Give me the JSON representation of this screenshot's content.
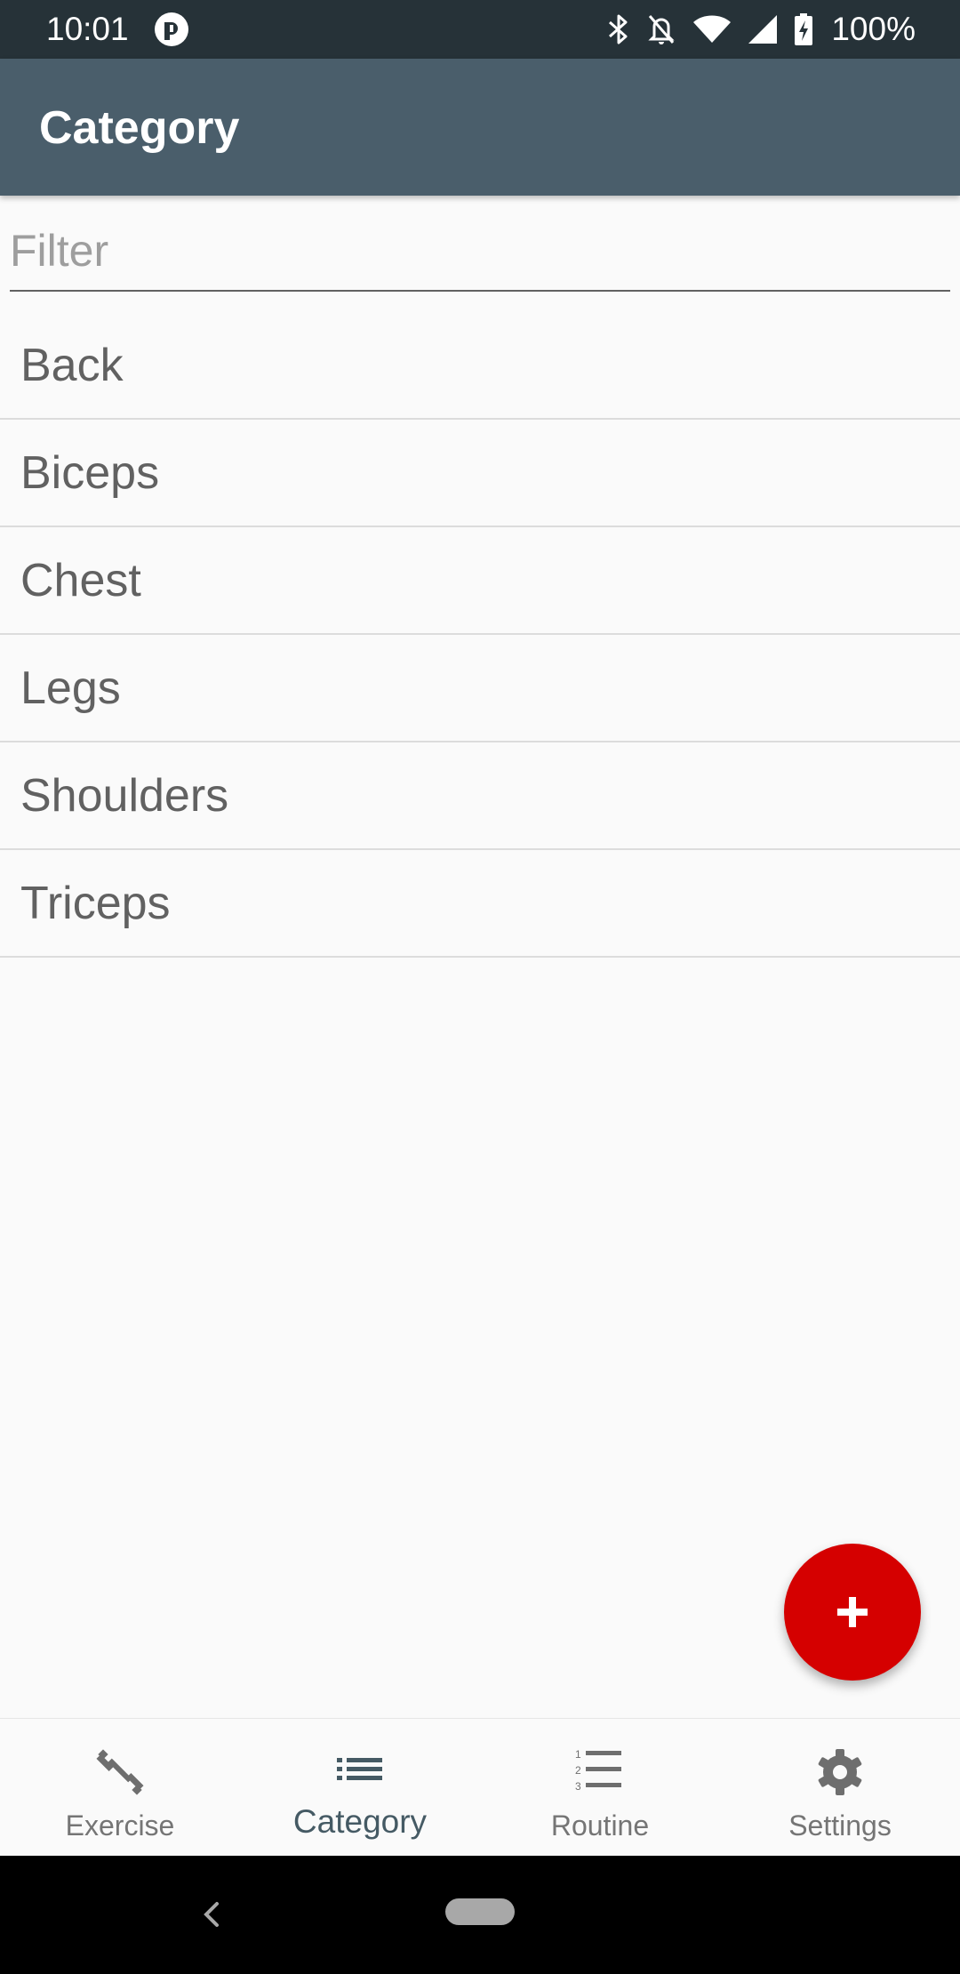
{
  "status_bar": {
    "time": "10:01",
    "battery_percent": "100%",
    "icons": [
      "app-notification-icon",
      "bluetooth-icon",
      "notifications-off-icon",
      "wifi-icon",
      "cell-signal-icon",
      "battery-charging-icon"
    ]
  },
  "app_bar": {
    "title": "Category",
    "background_color": "#4a5e6b"
  },
  "filter": {
    "placeholder": "Filter",
    "value": ""
  },
  "categories": [
    {
      "label": "Back"
    },
    {
      "label": "Biceps"
    },
    {
      "label": "Chest"
    },
    {
      "label": "Legs"
    },
    {
      "label": "Shoulders"
    },
    {
      "label": "Triceps"
    }
  ],
  "fab": {
    "icon": "plus-icon",
    "color": "#d50000"
  },
  "bottom_nav": {
    "items": [
      {
        "label": "Exercise",
        "icon": "dumbbell-icon",
        "active": false
      },
      {
        "label": "Category",
        "icon": "list-icon",
        "active": true
      },
      {
        "label": "Routine",
        "icon": "numbered-list-icon",
        "active": false
      },
      {
        "label": "Settings",
        "icon": "gear-icon",
        "active": false
      }
    ]
  },
  "system_nav": {
    "icons": [
      "back-icon",
      "home-pill-icon"
    ]
  }
}
